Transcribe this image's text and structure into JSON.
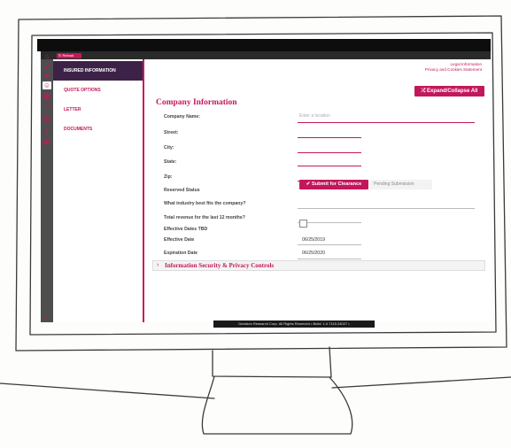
{
  "toolbar": {
    "reload_label": "Reload"
  },
  "rail_icons": [
    "home-icon",
    "search-icon",
    "users-icon",
    "user-icon",
    "chart-icon",
    "help-icon",
    "document-icon",
    "car-icon",
    "folder-icon",
    "expand-arrow-icon"
  ],
  "nav": {
    "items": [
      {
        "label": "INSURED INFORMATION",
        "active": true
      },
      {
        "label": "QUOTE OPTIONS",
        "active": false
      },
      {
        "label": "LETTER",
        "active": false
      },
      {
        "label": "DOCUMENTS",
        "active": false
      }
    ]
  },
  "header": {
    "legal_link": "Legal Information",
    "privacy_link": "Privacy and Cookies Statement",
    "expand_label": "Expand/Collapse All"
  },
  "form": {
    "title": "Company Information",
    "company_name_label": "Company Name:",
    "company_name_placeholder": "Enter a location",
    "street_label": "Street:",
    "city_label": "City:",
    "state_label": "State:",
    "zip_label": "Zip:",
    "reserved_label": "Reserved Status",
    "submit_label": "Submit for Clearance",
    "pending_label": "Pending Submission",
    "industry_label": "What industry best fits the company?",
    "revenue_label": "Total revenue for the last 12 months?",
    "dates_tbd_label": "Effective Dates TBD",
    "effective_label": "Effective Date",
    "effective_value": "06/25/2019",
    "expiration_label": "Expiration Date",
    "expiration_value": "06/25/2020"
  },
  "security_section": {
    "label": "Information Security & Privacy Controls"
  },
  "footer": {
    "text": "Decision Research Corp. All Rights Reserved • Build: 1.0.7115.24027 •"
  },
  "colors": {
    "accent": "#c2185b",
    "nav_active": "#3d2247"
  }
}
